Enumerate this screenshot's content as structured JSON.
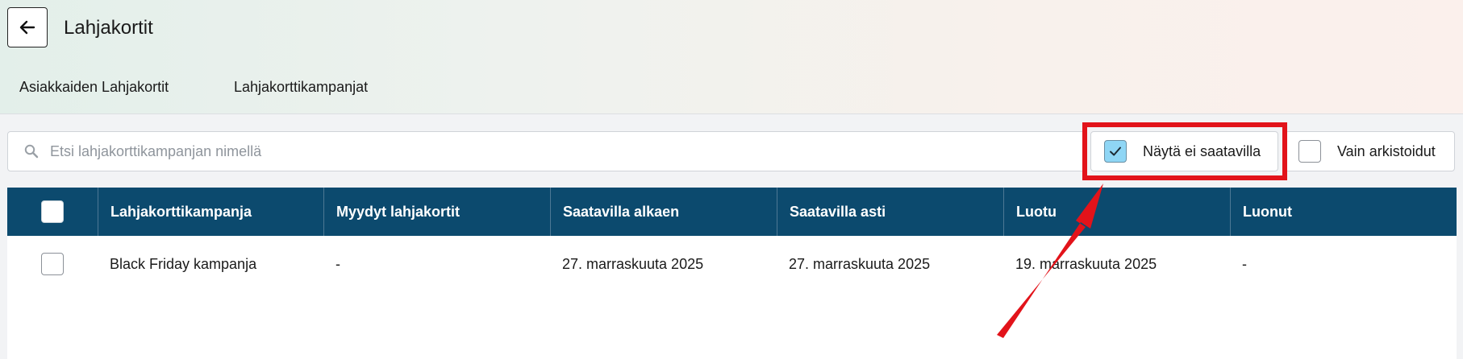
{
  "header": {
    "title": "Lahjakortit",
    "back_icon": "arrow-left-icon"
  },
  "tabs": [
    {
      "label": "Asiakkaiden Lahjakortit"
    },
    {
      "label": "Lahjakorttikampanjat"
    }
  ],
  "search": {
    "placeholder": "Etsi lahjakorttikampanjan nimellä",
    "value": "",
    "icon": "search-icon"
  },
  "filters": [
    {
      "label": "Näytä ei saatavilla",
      "checked": true
    },
    {
      "label": "Vain arkistoidut",
      "checked": false
    }
  ],
  "table": {
    "columns": [
      "Lahjakorttikampanja",
      "Myydyt lahjakortit",
      "Saatavilla alkaen",
      "Saatavilla asti",
      "Luotu",
      "Luonut"
    ],
    "rows": [
      {
        "checked": false,
        "cells": [
          "Black Friday kampanja",
          "-",
          "27. marraskuuta 2025",
          "27. marraskuuta 2025",
          "19. marraskuuta 2025",
          "-"
        ]
      }
    ]
  },
  "colors": {
    "table_header": "#0c4a6e",
    "checkbox_checked": "#8fd6f5",
    "annotation_red": "#e2131a"
  }
}
